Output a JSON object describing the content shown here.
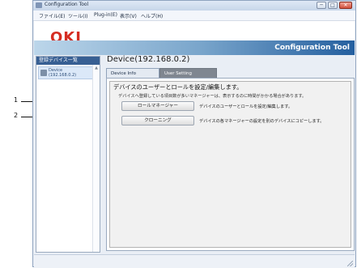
{
  "window": {
    "title": "Configuration Tool",
    "buttons": {
      "minimize": "─",
      "maximize": "□",
      "close": "✕"
    }
  },
  "menu": {
    "file": "ファイル(E)",
    "tool": "ツール(I)",
    "plugin": "Plug-in(E)",
    "view": "表示(V)",
    "help": "ヘルプ(H)"
  },
  "brand": {
    "logo": "OKI",
    "app_title": "Configuration Tool"
  },
  "sidebar": {
    "header": "登録デバイス一覧",
    "device_name": "Device",
    "device_ip": "(192.168.0.2)",
    "scroll_up": "▲"
  },
  "main": {
    "device_title": "Device(192.168.0.2)",
    "tabs": {
      "device_info": "Device Info",
      "user_setting": "User Setting"
    },
    "heading": "デバイスのユーザーとロールを設定/編集します。",
    "note": "デバイスへ登録している項目数が多いマネージャーは、表示するのに時間がかかる場合があります。",
    "actions": {
      "role_manager_button": "ロールマネージャー",
      "role_manager_desc": "デバイスのユーザーとロールを設定/編集します。",
      "cloning_button": "クローニング",
      "cloning_desc": "デバイスの各マネージャーの設定を別のデバイスにコピーします。"
    }
  },
  "callouts": {
    "one": "1",
    "two": "2"
  },
  "colors": {
    "oki_red": "#d52d22",
    "header_blue": "#245f9f",
    "sidebar_header": "#375f93"
  }
}
